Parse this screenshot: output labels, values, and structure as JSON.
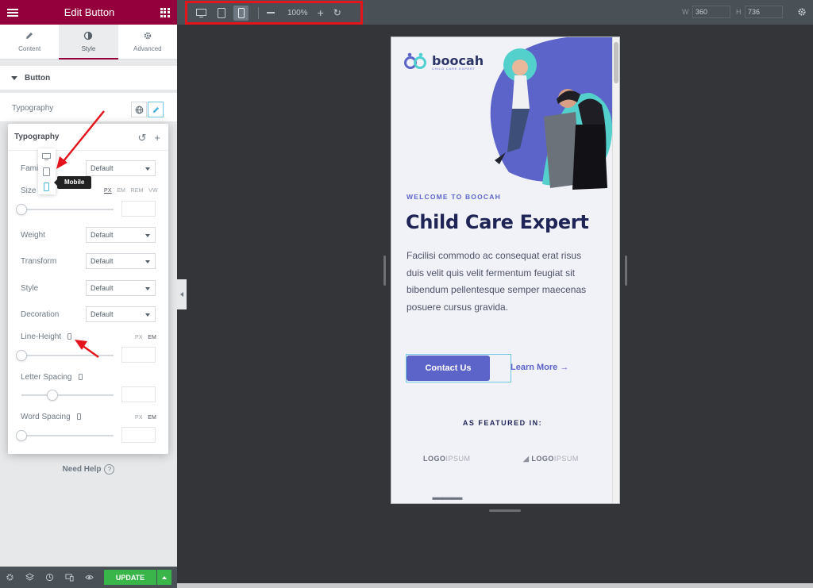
{
  "panel": {
    "title": "Edit Button",
    "tabs": [
      {
        "label": "Content",
        "icon": "pencil-icon"
      },
      {
        "label": "Style",
        "icon": "contrast-icon"
      },
      {
        "label": "Advanced",
        "icon": "gear-icon"
      }
    ],
    "section_title": "Button",
    "typography_label": "Typography",
    "need_help": "Need Help",
    "update_label": "UPDATE"
  },
  "typography_popover": {
    "title": "Typography",
    "family_label": "Fami",
    "family_value": "Default",
    "size_label": "Size",
    "size_units": [
      "PX",
      "EM",
      "REM",
      "VW"
    ],
    "weight_label": "Weight",
    "weight_value": "Default",
    "transform_label": "Transform",
    "transform_value": "Default",
    "style_label": "Style",
    "style_value": "Default",
    "decoration_label": "Decoration",
    "decoration_value": "Default",
    "line_height_label": "Line-Height",
    "line_height_units": [
      "PX",
      "EM"
    ],
    "letter_spacing_label": "Letter Spacing",
    "word_spacing_label": "Word Spacing",
    "word_spacing_units": [
      "PX",
      "EM"
    ],
    "tooltip": "Mobile"
  },
  "topbar": {
    "zoom": "100%",
    "width_label": "W",
    "width_value": "360",
    "height_label": "H",
    "height_value": "736"
  },
  "preview": {
    "logo_name": "boocah",
    "logo_tagline": "CHILD CARE EXPERT",
    "welcome": "WELCOME TO BOOCAH",
    "headline": "Child Care Expert",
    "body": "Facilisi commodo ac consequat erat risus duis velit quis velit fermentum feugiat sit bibendum pellentesque semper maecenas posuere cursus gravida.",
    "contact_button": "Contact Us",
    "learn_more": "Learn More →",
    "featured": "AS FEATURED IN:",
    "partner_logos": [
      {
        "bold": "LOGO",
        "light": "IPSUM"
      },
      {
        "bold": "LOGO",
        "light": "IPSUM"
      }
    ]
  },
  "colors": {
    "header": "#93003c",
    "accent": "#5c63c9",
    "headline": "#1f2456",
    "update": "#39b54a",
    "highlight_box": "#e3141b"
  }
}
